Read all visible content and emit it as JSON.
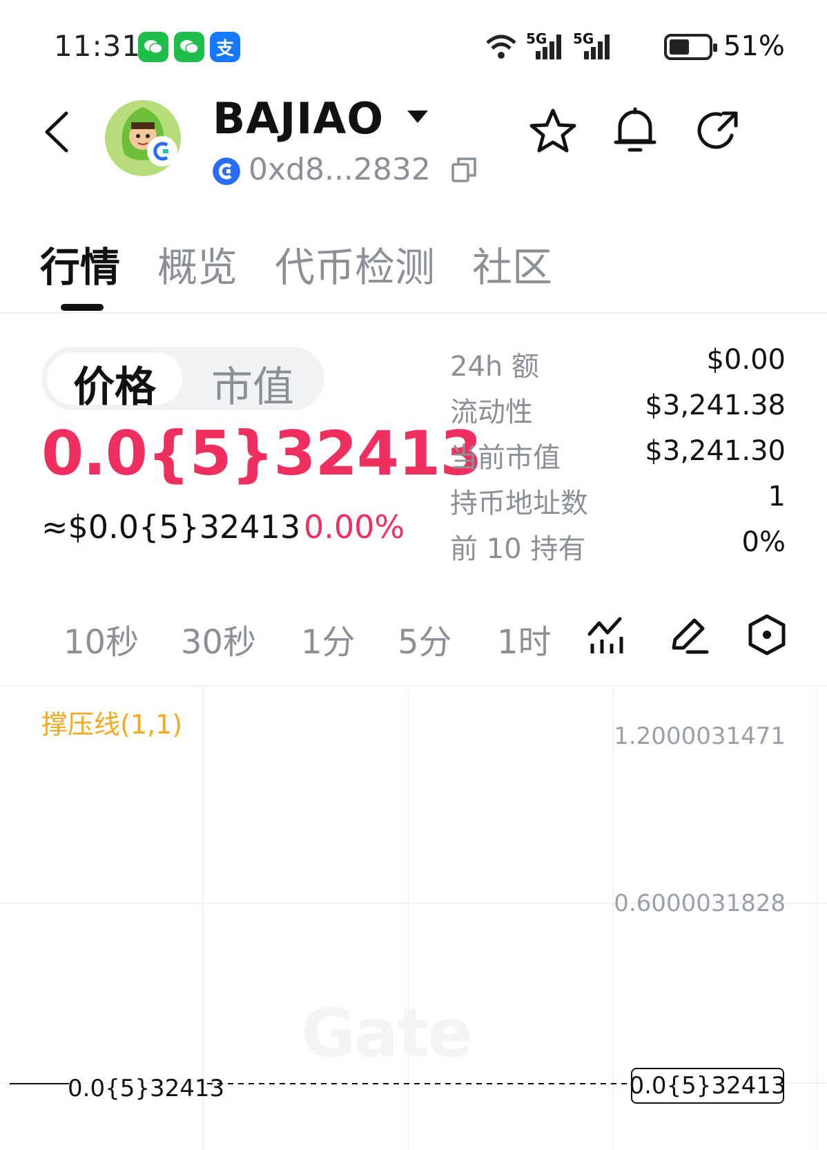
{
  "status_bar": {
    "time": "11:31",
    "apps": [
      "wechat-icon",
      "wechat-icon",
      "alipay-icon"
    ],
    "alipay_glyph": "支",
    "network_1": "5G",
    "network_2": "5G",
    "battery_level": 0.51,
    "battery_pct": "51%"
  },
  "header": {
    "token_name": "BAJIAO",
    "address": "0xd8...2832",
    "actions": [
      "star-icon",
      "bell-icon",
      "share-icon"
    ]
  },
  "tabs": [
    {
      "label": "行情",
      "active": true
    },
    {
      "label": "概览",
      "active": false
    },
    {
      "label": "代币检测",
      "active": false
    },
    {
      "label": "社区",
      "active": false
    }
  ],
  "price_panel": {
    "toggle": [
      "价格",
      "市值"
    ],
    "toggle_selected": "价格",
    "price": "0.0{5}32413",
    "price_usd": "≈$0.0{5}32413",
    "change": "0.00%"
  },
  "stats": [
    {
      "label": "24h  额",
      "value": "$0.00"
    },
    {
      "label": "流动性",
      "value": "$3,241.38"
    },
    {
      "label": "当前市值",
      "value": "$3,241.30"
    },
    {
      "label": "持币地址数",
      "value": "1"
    },
    {
      "label": "前 10 持有",
      "value": "0%"
    }
  ],
  "intervals": [
    "10秒",
    "30秒",
    "1分",
    "5分",
    "1时"
  ],
  "chart": {
    "indicator": "撑压线(1,1)",
    "y_ticks": [
      "1.2000031471",
      "0.6000031828"
    ],
    "watermark": "Gate",
    "price_line_label_left": "0.0{5}32413",
    "price_line_label_right": "0.0{5}32413"
  },
  "colors": {
    "accent_red": "#ef2f5e",
    "indicator": "#f3a920",
    "muted": "#8b8f96"
  }
}
